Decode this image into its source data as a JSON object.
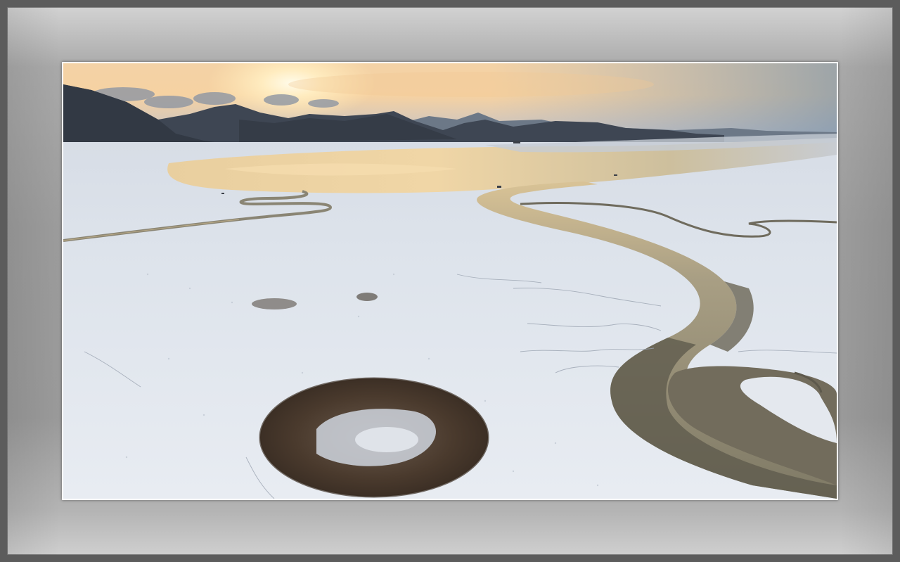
{
  "image": {
    "subject": "aerial-tidal-flat-winter-sunset",
    "palette": {
      "sky_glow": "#f7d6a0",
      "sky_high": "#9fb2c4",
      "mountains": "#3c4450",
      "snow_flat": "#e6ebf2",
      "channel_water": "#8f8a72",
      "reed_patch": "#4a3a2c",
      "mat_light": "#d2d2d2",
      "mat_mid": "#9c9c9c"
    }
  }
}
